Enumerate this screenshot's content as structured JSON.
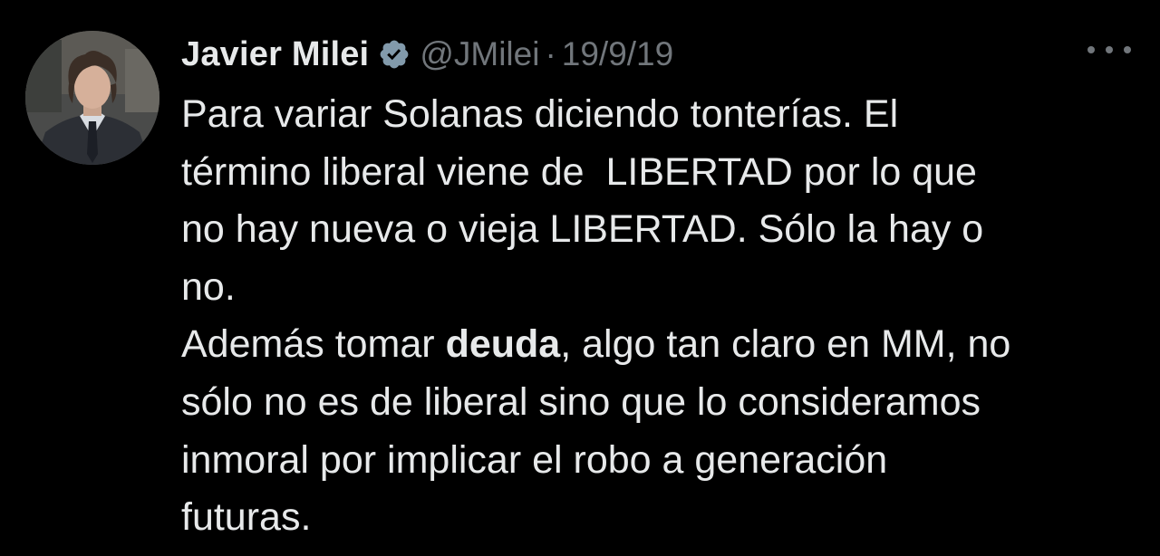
{
  "tweet": {
    "author": {
      "name": "Javier Milei",
      "handle": "@JMilei",
      "verified": true,
      "avatar_icon": "profile-photo"
    },
    "separator": "·",
    "date": "19/9/19",
    "more_icon": "more-horizontal-icon",
    "body_lines": [
      "Para variar Solanas diciendo tonterías. El",
      "término liberal viene de  LIBERTAD por lo que",
      "no hay nueva o vieja LIBERTAD. Sólo la hay o",
      "no."
    ],
    "line5": {
      "before": "Además tomar ",
      "bold": "deuda",
      "after": ", algo tan claro en MM, no"
    },
    "body_lines_end": [
      "sólo no es de liberal sino que lo consideramos",
      "inmoral por implicar el robo a generación",
      "futuras."
    ]
  },
  "colors": {
    "background": "#000000",
    "text_primary": "#e7e9ea",
    "text_secondary": "#71767b",
    "verified_badge": "#829aab"
  }
}
